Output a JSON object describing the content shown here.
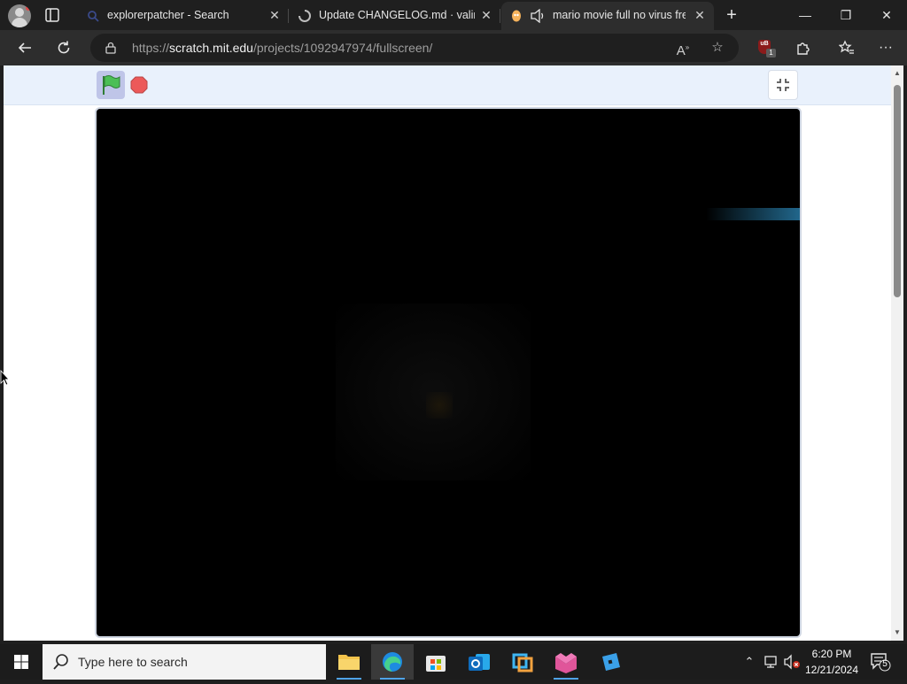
{
  "browser": {
    "tabs": [
      {
        "label": "explorerpatcher - Search",
        "icon": "search-favicon"
      },
      {
        "label": "Update CHANGELOG.md · valinet/",
        "icon": "loading-spinner-icon"
      },
      {
        "label": "mario movie full no virus free",
        "icon": "scratch-favicon",
        "audio_icon": "speaker-icon"
      }
    ],
    "new_tab_label": "+",
    "window_controls": {
      "minimize": "—",
      "restore": "❐",
      "close": "✕"
    }
  },
  "address_bar": {
    "scheme": "https://",
    "host": "scratch.mit.edu",
    "path": "/projects/1092947974/fullscreen/"
  },
  "player": {
    "green_flag_icon": "green-flag-icon",
    "stop_icon": "stop-sign-icon",
    "exit_fullscreen_icon": "exit-fullscreen-icon",
    "stage_background": "#000000"
  },
  "taskbar": {
    "search_placeholder": "Type here to search",
    "apps": [
      "file-explorer-icon",
      "edge-icon",
      "microsoft-store-icon",
      "outlook-icon",
      "app-icon",
      "roblox-studio-icon",
      "roblox-icon"
    ],
    "clock": {
      "time": "6:20 PM",
      "date": "12/21/2024"
    },
    "notification_count": "5"
  },
  "colors": {
    "accent": "#4fa3e8",
    "player_bar": "#e9f1fc",
    "flag_green": "#4cbf56",
    "stop_red": "#ec5959"
  }
}
